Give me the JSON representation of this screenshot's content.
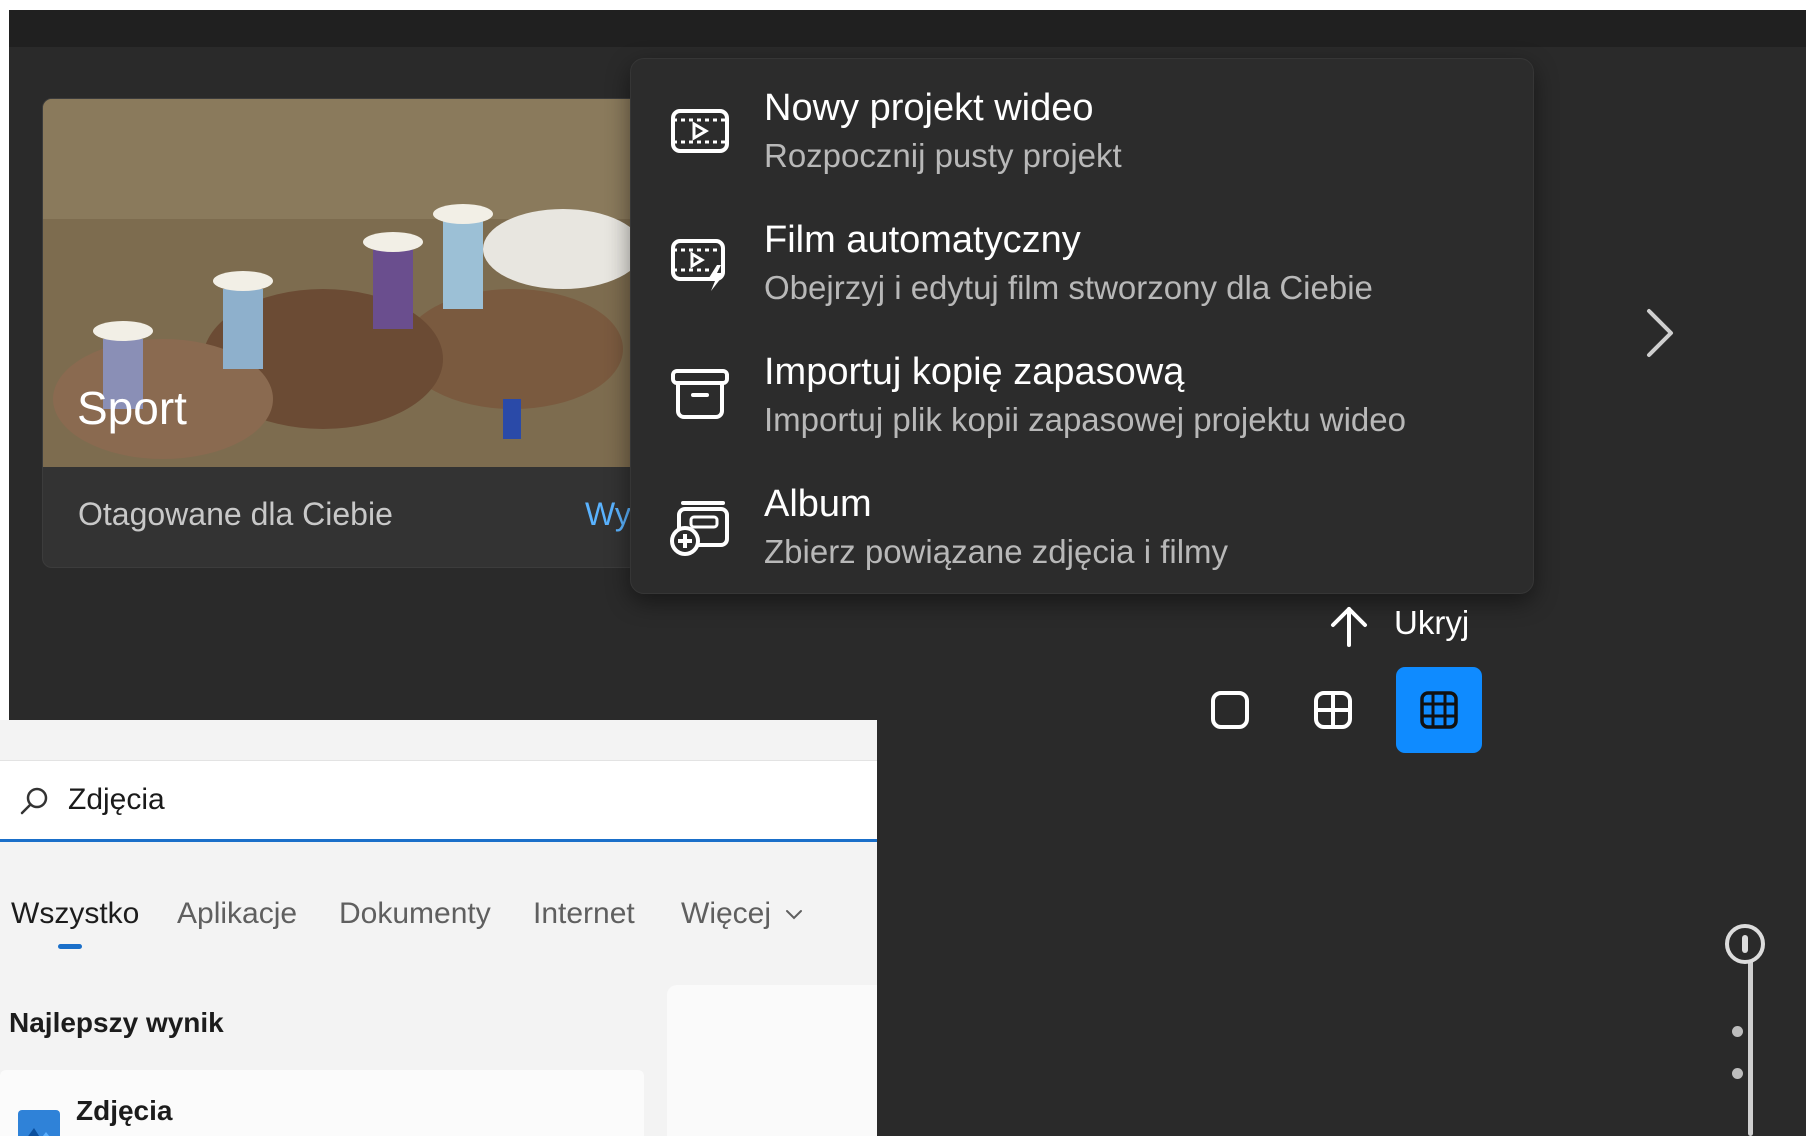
{
  "photos_app": {
    "card": {
      "title": "Sport",
      "caption": "Otagowane dla Ciebie",
      "link_label": "Wy"
    },
    "create_menu": {
      "items": [
        {
          "title": "Nowy projekt wideo",
          "subtitle": "Rozpocznij pusty projekt",
          "icon": "video-project-icon"
        },
        {
          "title": "Film automatyczny",
          "subtitle": "Obejrzyj i edytuj film stworzony dla Ciebie",
          "icon": "auto-movie-icon"
        },
        {
          "title": "Importuj kopię zapasową",
          "subtitle": "Importuj plik kopii zapasowej projektu wideo",
          "icon": "archive-icon"
        },
        {
          "title": "Album",
          "subtitle": "Zbierz powiązane zdjęcia i filmy",
          "icon": "album-add-icon"
        }
      ]
    },
    "hide_label": "Ukryj",
    "view_buttons": [
      {
        "icon": "single-view-icon",
        "active": false
      },
      {
        "icon": "medium-grid-icon",
        "active": false
      },
      {
        "icon": "small-grid-icon",
        "active": true
      }
    ],
    "accent_color": "#0f8bff"
  },
  "search_panel": {
    "query": "Zdjęcia",
    "tabs": [
      {
        "label": "Wszystko",
        "active": true
      },
      {
        "label": "Aplikacje"
      },
      {
        "label": "Dokumenty"
      },
      {
        "label": "Internet"
      },
      {
        "label": "Więcej"
      }
    ],
    "best_match_label": "Najlepszy wynik",
    "best_match_app": "Zdjęcia",
    "accent_color": "#1a6fc9"
  }
}
